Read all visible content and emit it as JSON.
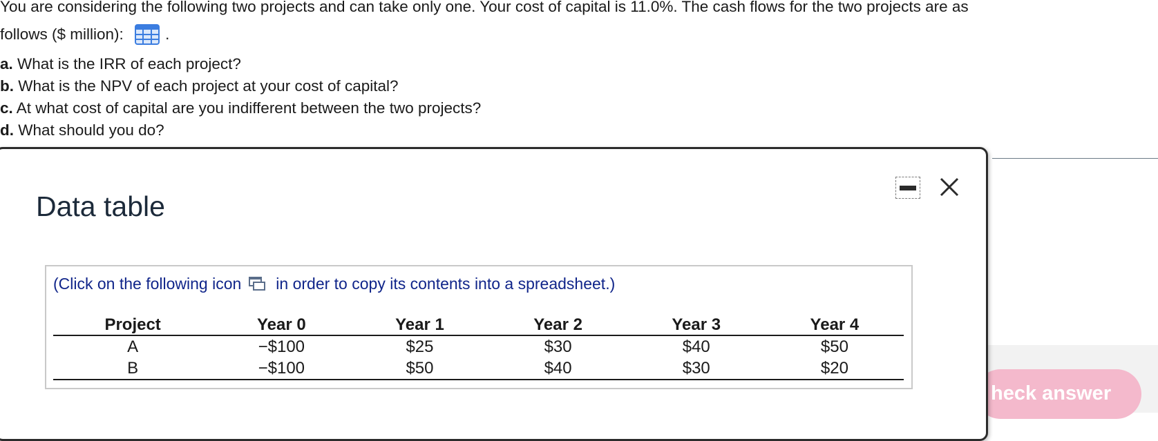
{
  "question": {
    "line1": "You are considering the following two projects and can take only one. Your cost of capital is 11.0%. The cash flows for the two projects are as",
    "line2": "follows ($ million):",
    "line2_end": ".",
    "data_icon": "spreadsheet-grid-icon",
    "parts": [
      {
        "label": "a.",
        "text": " What is the IRR of each project?"
      },
      {
        "label": "b.",
        "text": " What is the NPV of each project at your cost of capital?"
      },
      {
        "label": "c.",
        "text": " At what cost of capital are you indifferent between the two projects?"
      },
      {
        "label": "d.",
        "text": " What should you do?"
      }
    ]
  },
  "dialog": {
    "title": "Data table",
    "minimize_icon": "minimize-icon",
    "close_icon": "close-icon",
    "copy_note_before": "(Click on the following icon",
    "copy_note_after": "in order to copy its contents into a spreadsheet.)",
    "copy_icon": "copy-to-spreadsheet-icon",
    "table": {
      "headers": [
        "Project",
        "Year 0",
        "Year 1",
        "Year 2",
        "Year 3",
        "Year 4"
      ],
      "rows": [
        [
          "A",
          "−$100",
          "$25",
          "$30",
          "$40",
          "$50"
        ],
        [
          "B",
          "−$100",
          "$50",
          "$40",
          "$30",
          "$20"
        ]
      ]
    }
  },
  "check_answer_label": "heck answer",
  "colors": {
    "link_blue": "#10258a",
    "check_button_bg": "#f4b9cc",
    "dialog_border": "#2b2b2b",
    "icon_blue": "#3b7de0"
  }
}
